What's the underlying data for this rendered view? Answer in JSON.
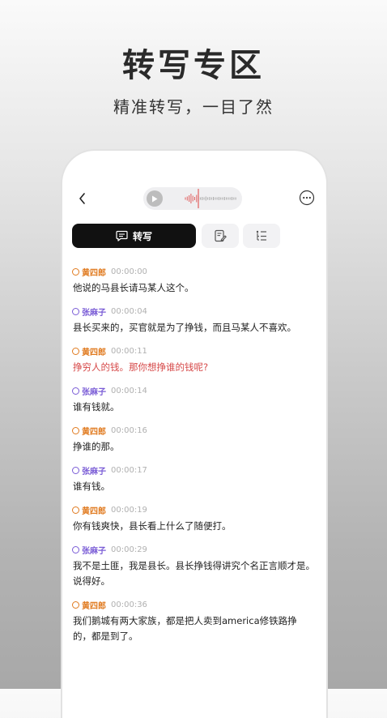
{
  "hero": {
    "title": "转写专区",
    "subtitle": "精准转写，一目了然"
  },
  "colors": {
    "speaker_a": "#e07a1f",
    "speaker_b": "#7a5cd6",
    "highlight": "#d64848",
    "tab_active_bg": "#111111"
  },
  "topbar": {
    "back_icon": "chevron-left-icon",
    "play_icon": "play-icon",
    "more_icon": "more-horizontal-icon"
  },
  "tabs": {
    "transcript_label": "转写",
    "transcript_icon": "chat-bubble-icon",
    "notes_icon": "edit-note-icon",
    "outline_icon": "list-outline-icon"
  },
  "transcript": [
    {
      "speaker": "黄四郎",
      "time": "00:00:00",
      "text": "他说的马县长请马某人这个。",
      "color": "speaker_a",
      "highlight": false
    },
    {
      "speaker": "张麻子",
      "time": "00:00:04",
      "text": "县长买来的，买官就是为了挣钱，而且马某人不喜欢。",
      "color": "speaker_b",
      "highlight": false
    },
    {
      "speaker": "黄四郎",
      "time": "00:00:11",
      "text": "挣穷人的钱。那你想挣谁的钱呢?",
      "color": "speaker_a",
      "highlight": true
    },
    {
      "speaker": "张麻子",
      "time": "00:00:14",
      "text": "谁有钱就。",
      "color": "speaker_b",
      "highlight": false
    },
    {
      "speaker": "黄四郎",
      "time": "00:00:16",
      "text": "挣谁的那。",
      "color": "speaker_a",
      "highlight": false
    },
    {
      "speaker": "张麻子",
      "time": "00:00:17",
      "text": "谁有钱。",
      "color": "speaker_b",
      "highlight": false
    },
    {
      "speaker": "黄四郎",
      "time": "00:00:19",
      "text": "你有钱爽快，县长看上什么了随便打。",
      "color": "speaker_a",
      "highlight": false
    },
    {
      "speaker": "张麻子",
      "time": "00:00:29",
      "text": "我不是土匪，我是县长。县长挣钱得讲究个名正言顺才是。说得好。",
      "color": "speaker_b",
      "highlight": false
    },
    {
      "speaker": "黄四郎",
      "time": "00:00:36",
      "text": "我们鹅城有两大家族，都是把人卖到america修铁路挣的，都是到了。",
      "color": "speaker_a",
      "highlight": false
    }
  ]
}
